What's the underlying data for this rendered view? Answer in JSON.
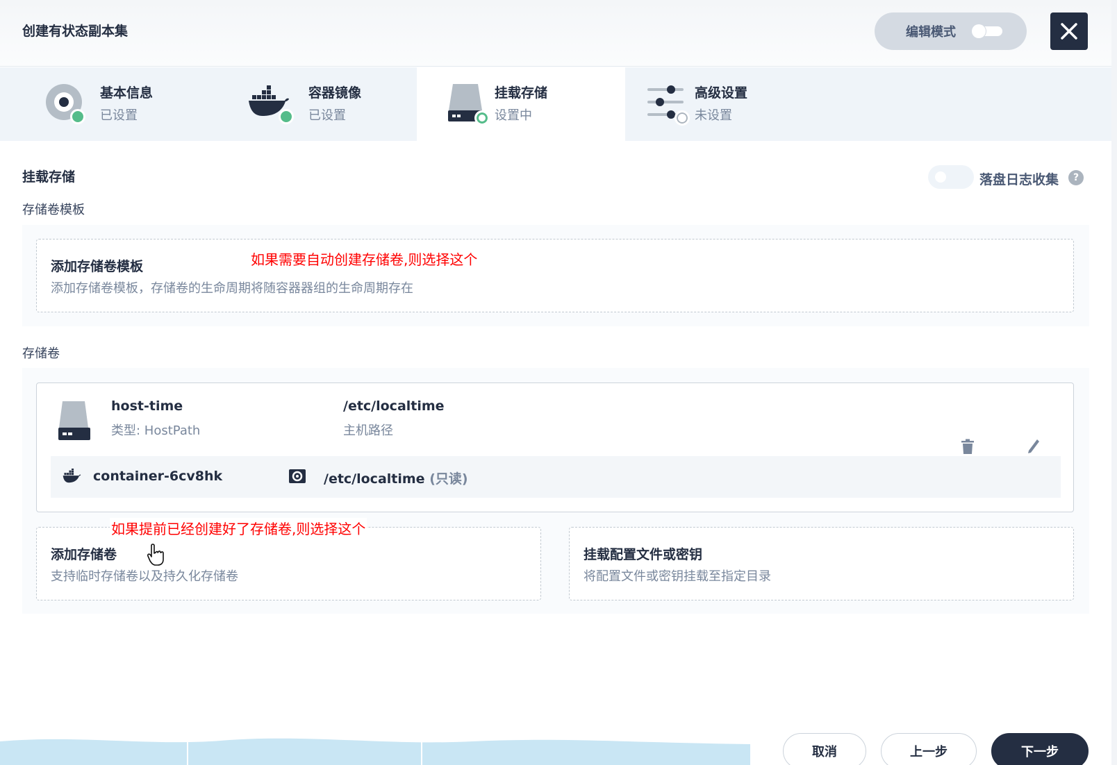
{
  "header": {
    "title": "创建有状态副本集",
    "edit_mode_label": "编辑模式"
  },
  "steps": [
    {
      "title": "基本信息",
      "status": "已设置",
      "icon": "disc-icon"
    },
    {
      "title": "容器镜像",
      "status": "已设置",
      "icon": "docker-whale-icon"
    },
    {
      "title": "挂载存储",
      "status": "设置中",
      "icon": "storage-drive-icon"
    },
    {
      "title": "高级设置",
      "status": "未设置",
      "icon": "sliders-icon"
    }
  ],
  "section": {
    "title": "挂载存储",
    "log_collection_label": "落盘日志收集",
    "help_icon": "?"
  },
  "volume_templates": {
    "label": "存储卷模板",
    "add_title": "添加存储卷模板",
    "add_desc": "添加存储卷模板，存储卷的生命周期将随容器器组的生命周期存在",
    "annotation": "如果需要自动创建存储卷,则选择这个"
  },
  "volumes": {
    "label": "存储卷",
    "items": [
      {
        "name": "host-time",
        "type": "类型: HostPath",
        "path": "/etc/localtime",
        "path_label": "主机路径",
        "mount": {
          "container": "container-6cv8hk",
          "path": "/etc/localtime",
          "mode": "(只读)"
        }
      }
    ],
    "annotation": "如果提前已经创建好了存储卷,则选择这个",
    "add_title": "添加存储卷",
    "add_desc": "支持临时存储卷以及持久化存储卷",
    "mount_config_title": "挂载配置文件或密钥",
    "mount_config_desc": "将配置文件或密钥挂载至指定目录"
  },
  "footer": {
    "cancel": "取消",
    "prev": "上一步",
    "next": "下一步"
  },
  "colors": {
    "primary_dark": "#242e42",
    "success_green": "#55bc8a",
    "annotation_red": "#ff0000"
  }
}
